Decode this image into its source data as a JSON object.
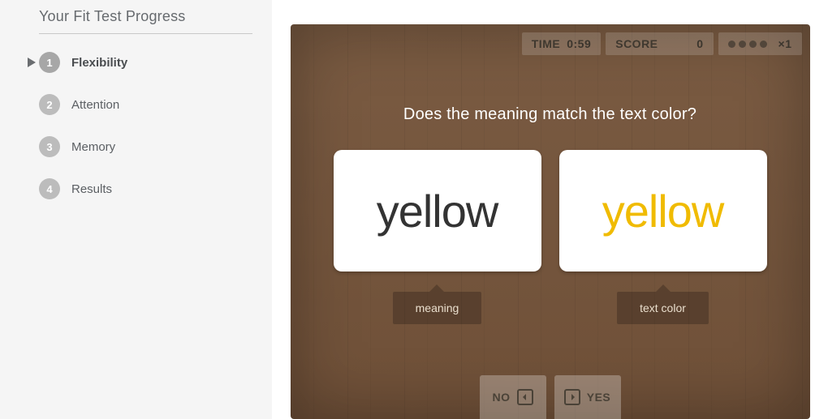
{
  "sidebar": {
    "title": "Your Fit Test Progress",
    "steps": [
      {
        "num": "1",
        "label": "Flexibility",
        "active": true
      },
      {
        "num": "2",
        "label": "Attention",
        "active": false
      },
      {
        "num": "3",
        "label": "Memory",
        "active": false
      },
      {
        "num": "4",
        "label": "Results",
        "active": false
      }
    ]
  },
  "hud": {
    "time_label": "TIME",
    "time_value": "0:59",
    "score_label": "SCORE",
    "score_value": "0",
    "multiplier": "×1"
  },
  "game": {
    "question": "Does the meaning match the text color?",
    "meaning_word": "yellow",
    "color_word": "yellow",
    "meaning_caption": "meaning",
    "color_caption": "text color",
    "no_label": "NO",
    "yes_label": "YES"
  }
}
